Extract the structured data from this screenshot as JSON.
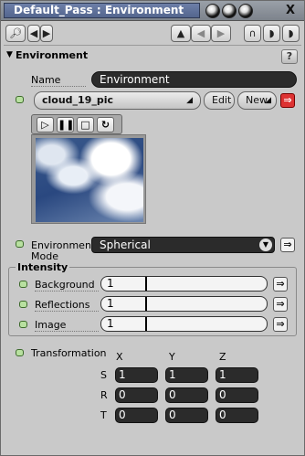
{
  "window": {
    "title": "Default_Pass : Environment",
    "close_label": "X"
  },
  "section": {
    "title": "Environment",
    "help_label": "?"
  },
  "name_field": {
    "label": "Name",
    "value": "Environment"
  },
  "image_clip": {
    "value": "cloud_19_pic",
    "edit_label": "Edit",
    "new_label": "New"
  },
  "environment_mode": {
    "label_line1": "Environment",
    "label_line2": "Mode",
    "value": "Spherical"
  },
  "intensity": {
    "title": "Intensity",
    "rows": [
      {
        "label": "Background",
        "value": "1"
      },
      {
        "label": "Reflections",
        "value": "1"
      },
      {
        "label": "Image",
        "value": "1"
      }
    ]
  },
  "transformation": {
    "label": "Transformation",
    "axes": [
      "X",
      "Y",
      "Z"
    ],
    "rows": [
      {
        "label": "S",
        "values": [
          "1",
          "1",
          "1"
        ]
      },
      {
        "label": "R",
        "values": [
          "0",
          "0",
          "0"
        ]
      },
      {
        "label": "T",
        "values": [
          "0",
          "0",
          "0"
        ]
      }
    ]
  }
}
